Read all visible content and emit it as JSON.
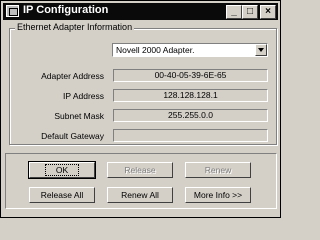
{
  "window": {
    "title": "IP Configuration",
    "minimize": "_",
    "maximize": "□",
    "close": "×"
  },
  "group": {
    "legend": "Ethernet  Adapter Information",
    "adapter_selected": "Novell 2000 Adapter."
  },
  "fields": [
    {
      "label": "Adapter Address",
      "value": "00-40-05-39-6E-65"
    },
    {
      "label": "IP Address",
      "value": "128.128.128.1"
    },
    {
      "label": "Subnet Mask",
      "value": "255.255.0.0"
    },
    {
      "label": "Default Gateway",
      "value": ""
    }
  ],
  "buttons": {
    "ok": "OK",
    "release": "Release",
    "renew": "Renew",
    "release_all": "Release All",
    "renew_all": "Renew All",
    "more_info": "More Info >>"
  }
}
